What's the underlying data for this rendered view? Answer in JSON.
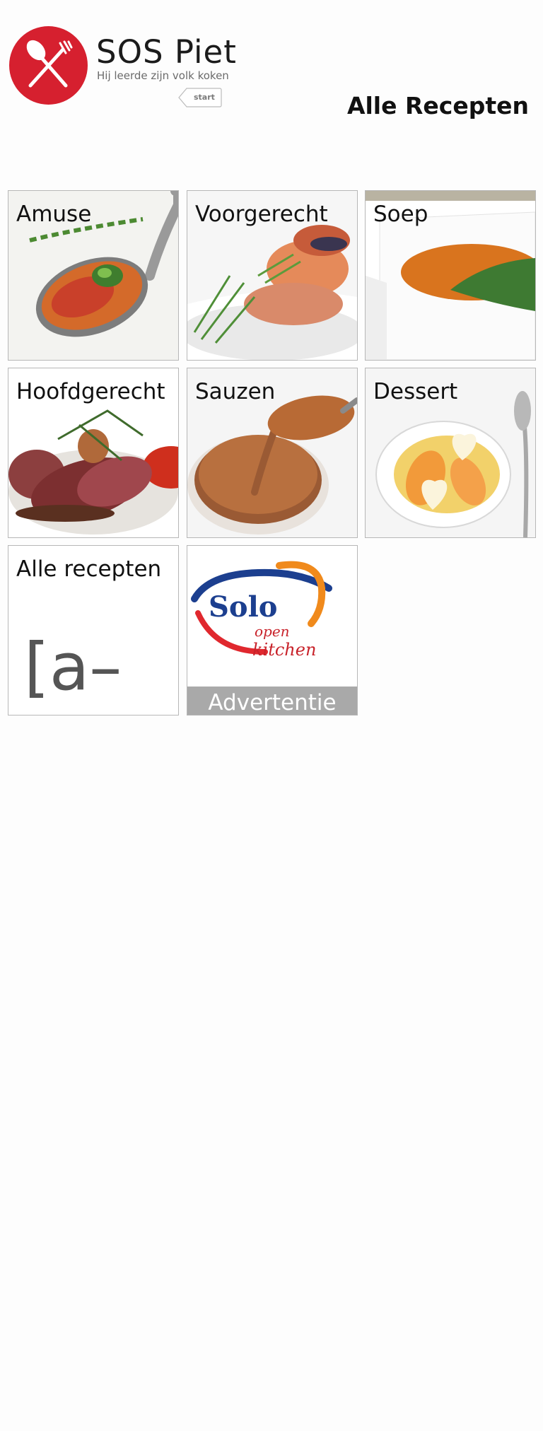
{
  "app": {
    "name": "SOS Piet",
    "tagline": "Hij leerde zijn volk koken",
    "start_label": "start",
    "page_title": "Alle Recepten"
  },
  "categories": [
    {
      "label": "Amuse",
      "icon": "spoon-appetizer-image"
    },
    {
      "label": "Voorgerecht",
      "icon": "prawn-starter-image"
    },
    {
      "label": "Soep",
      "icon": "soup-bowl-image"
    },
    {
      "label": "Hoofdgerecht",
      "icon": "sliced-meat-image"
    },
    {
      "label": "Sauzen",
      "icon": "sauce-spoon-image"
    },
    {
      "label": "Dessert",
      "icon": "heart-dessert-image"
    }
  ],
  "all_recipes": {
    "label": "Alle recepten",
    "az": "[a–Z]"
  },
  "advert": {
    "label": "Advertentie",
    "brand": "Solo",
    "brand_sub": "open kitchen"
  },
  "colors": {
    "brand_red": "#d6202f",
    "tile_border": "#b7b7b7",
    "ad_band": "#a9a9a9"
  }
}
